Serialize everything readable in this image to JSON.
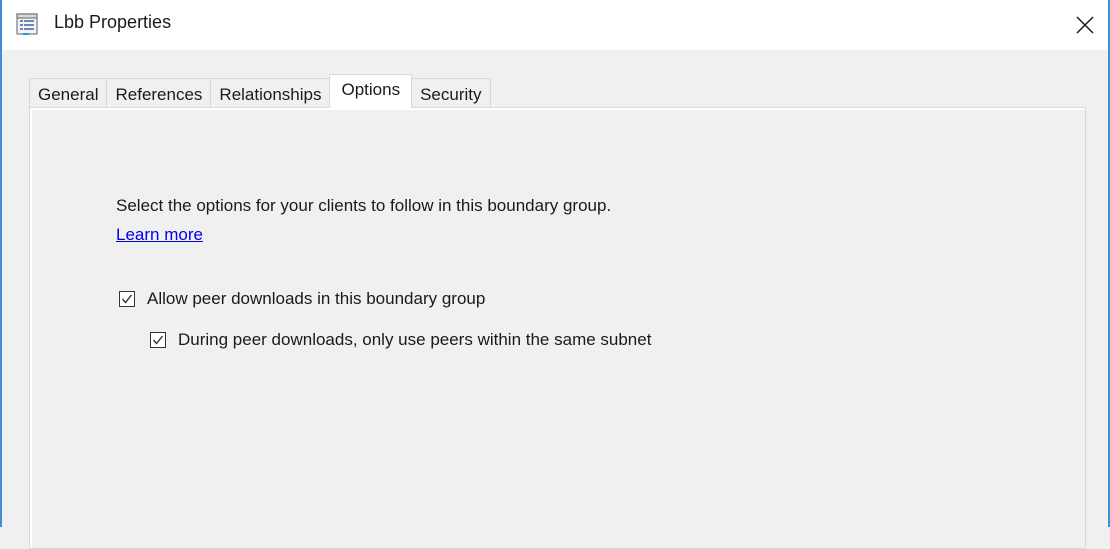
{
  "window": {
    "title": "Lbb Properties",
    "icon": "properties-dialog-icon",
    "close_icon": "close-icon"
  },
  "tabs": [
    {
      "label": "General",
      "active": false
    },
    {
      "label": "References",
      "active": false
    },
    {
      "label": "Relationships",
      "active": false
    },
    {
      "label": "Options",
      "active": true
    },
    {
      "label": "Security",
      "active": false
    }
  ],
  "options_panel": {
    "description": "Select the options for your clients to follow in this boundary group.",
    "learn_more_link": "Learn more",
    "checkboxes": [
      {
        "label": "Allow peer downloads in this boundary group",
        "checked": true
      },
      {
        "label": "During peer downloads, only use peers within the same subnet",
        "checked": true
      }
    ]
  },
  "colors": {
    "window_border": "#3c8fd6",
    "link": "#0000ee",
    "background": "#f0f0f0"
  }
}
